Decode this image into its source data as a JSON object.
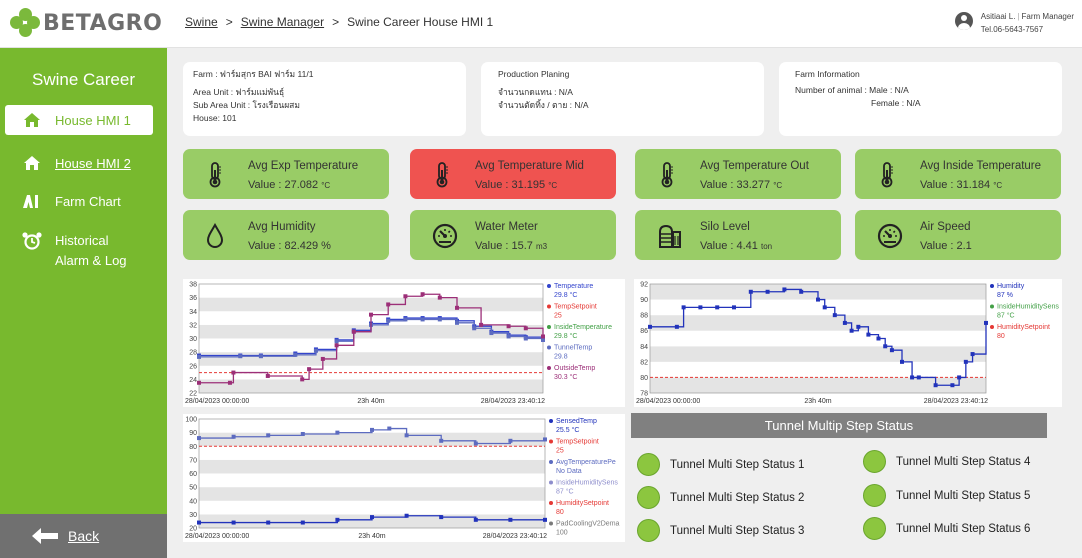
{
  "brand": {
    "name": "BETAGRO",
    "accent": "#78b92e",
    "card_green": "#99cc66",
    "alarm_red": "#ef5350"
  },
  "breadcrumb": {
    "root": "Swine",
    "sep1": ">",
    "section": "Swine Manager",
    "sep2": ">",
    "current": "Swine Career House HMI 1"
  },
  "user": {
    "name": "Asitiaai L.",
    "role": "Farm Manager",
    "phone": "Tel.06-5643-7567"
  },
  "sidebar": {
    "title": "Swine Career",
    "items": [
      {
        "label": "House HMI 1",
        "icon": "house-icon"
      },
      {
        "label": "House HMI 2",
        "icon": "house-icon"
      },
      {
        "label": "Farm Chart",
        "icon": "chart-icon"
      },
      {
        "label": "Historical",
        "label2": "Alarm & Log",
        "icon": "alarm-clock-icon"
      }
    ],
    "back_label": "Back"
  },
  "farm": {
    "farm": "Farm :  ฟาร์มสุกร BAI ฟาร์ม 11/1",
    "area": "Area Unit :  ฟาร์มแม่พันธุ์",
    "sub_area": "Sub Area Unit :  โรงเรือนผสม",
    "house": "House:  101"
  },
  "production": {
    "title": "Production Planing",
    "line1": "จำนวนกดแทน :  N/A",
    "line2": "จำนวนตัดทิ้ง / ตาย :  N/A"
  },
  "farm_info": {
    "title": "Farm Information",
    "line1": "Number of animal : Male :  N/A",
    "line2": "Female :  N/A"
  },
  "cards": [
    {
      "label": "Avg Exp Temperature",
      "value": "Value :   27.082",
      "unit": "°C",
      "icon": "thermometer-icon"
    },
    {
      "label": "Avg Temperature Mid",
      "value": "Value :   31.195",
      "unit": "°C",
      "icon": "thermometer-icon"
    },
    {
      "label": "Avg Temperature Out",
      "value": "Value :  33.277",
      "unit": "°C",
      "icon": "thermometer-icon"
    },
    {
      "label": "Avg Inside Temperature",
      "value": "Value :  31.184",
      "unit": "°C",
      "icon": "thermometer-icon"
    },
    {
      "label": "Avg Humidity",
      "value": "Value : 82.429 %",
      "unit": "",
      "icon": "water-drop-icon"
    },
    {
      "label": "Water Meter",
      "value": "Value :  15.7",
      "unit": "m3",
      "icon": "gauge-icon"
    },
    {
      "label": "Silo Level",
      "value": "Value :  4.41",
      "unit": "ton",
      "icon": "silo-icon"
    },
    {
      "label": "Air Speed",
      "value": "Value :   2.1",
      "unit": "",
      "icon": "gauge-icon"
    }
  ],
  "chart_data": [
    {
      "type": "line",
      "x_labels": [
        "28/04/2023 00:00:00",
        "23h 40m",
        "28/04/2023 23:40:12"
      ],
      "ylim": [
        22,
        38
      ],
      "y_ticks": [
        22,
        24,
        26,
        28,
        30,
        32,
        34,
        36,
        38
      ],
      "setpoint": 25,
      "series": [
        {
          "name": "Temperature",
          "value_text": "29.8 °C",
          "color": "#3344cc",
          "x": [
            0,
            0.12,
            0.18,
            0.28,
            0.34,
            0.4,
            0.45,
            0.5,
            0.55,
            0.6,
            0.65,
            0.7,
            0.75,
            0.8,
            0.85,
            0.9,
            0.95,
            1.0
          ],
          "y": [
            27.5,
            27.5,
            27.5,
            27.8,
            28.4,
            29.8,
            31.2,
            32.2,
            32.8,
            33.0,
            33.0,
            33.0,
            32.6,
            31.8,
            31.0,
            30.5,
            30.2,
            29.8
          ]
        },
        {
          "name": "TempSetpoint",
          "value_text": "25",
          "color": "#e53935"
        },
        {
          "name": "InsideTemperature",
          "value_text": "29.8 °C",
          "color": "#43a047"
        },
        {
          "name": "TunnelTemp",
          "value_text": "29.8",
          "color": "#5c6bc0",
          "x": [
            0,
            0.12,
            0.18,
            0.28,
            0.34,
            0.4,
            0.45,
            0.5,
            0.55,
            0.6,
            0.65,
            0.7,
            0.75,
            0.8,
            0.85,
            0.9,
            0.95,
            1.0
          ],
          "y": [
            27.3,
            27.4,
            27.4,
            27.6,
            28.2,
            29.6,
            31.0,
            32.0,
            32.6,
            32.8,
            32.8,
            32.8,
            32.3,
            31.5,
            30.8,
            30.3,
            30.0,
            29.8
          ]
        },
        {
          "name": "OutsideTemp",
          "value_text": "30.3 °C",
          "color": "#9c2f78",
          "x": [
            0,
            0.09,
            0.1,
            0.2,
            0.3,
            0.32,
            0.36,
            0.4,
            0.45,
            0.5,
            0.55,
            0.6,
            0.65,
            0.7,
            0.75,
            0.82,
            0.9,
            0.95,
            1.0
          ],
          "y": [
            23.5,
            23.5,
            25.0,
            24.5,
            24.0,
            25.5,
            27.0,
            29.0,
            31.0,
            33.5,
            35.0,
            36.2,
            36.5,
            36.0,
            34.5,
            32.0,
            31.8,
            31.5,
            30.3
          ]
        }
      ]
    },
    {
      "type": "line",
      "x_labels": [
        "28/04/2023 00:00:00",
        "23h 40m",
        "28/04/2023 23:40:12"
      ],
      "ylim": [
        78,
        92
      ],
      "y_ticks": [
        78,
        80,
        82,
        84,
        86,
        88,
        90,
        92
      ],
      "setpoint": 80,
      "series": [
        {
          "name": "Humidity",
          "value_text": "87 %",
          "color": "#2233bb",
          "x": [
            0,
            0.08,
            0.1,
            0.15,
            0.2,
            0.25,
            0.3,
            0.35,
            0.4,
            0.45,
            0.5,
            0.52,
            0.55,
            0.58,
            0.6,
            0.62,
            0.65,
            0.68,
            0.7,
            0.72,
            0.75,
            0.78,
            0.8,
            0.85,
            0.9,
            0.92,
            0.94,
            0.96,
            1.0
          ],
          "y": [
            86.5,
            86.5,
            89,
            89,
            89,
            89,
            91,
            91,
            91.3,
            91,
            90,
            89,
            88,
            87,
            86,
            86.5,
            85.5,
            85,
            84,
            83.5,
            82,
            80,
            80,
            79,
            79,
            80,
            82,
            83,
            87
          ]
        },
        {
          "name": "InsideHumiditySens",
          "value_text": "87 °C",
          "color": "#43a047"
        },
        {
          "name": "HumiditySetpoint",
          "value_text": "80",
          "color": "#e53935"
        }
      ]
    },
    {
      "type": "line",
      "x_labels": [
        "28/04/2023 00:00:00",
        "23h 40m",
        "28/04/2023 23:40:12"
      ],
      "ylim": [
        20,
        100
      ],
      "y_ticks": [
        20,
        30,
        40,
        50,
        60,
        70,
        80,
        90,
        100
      ],
      "setpoint": 80,
      "series": [
        {
          "name": "SensedTemp",
          "value_text": "25.5 °C",
          "color": "#2233bb",
          "x": [
            0,
            0.1,
            0.2,
            0.3,
            0.4,
            0.5,
            0.6,
            0.7,
            0.8,
            0.9,
            1.0
          ],
          "y": [
            24,
            24,
            24,
            24,
            26,
            28,
            29,
            28,
            26,
            26,
            26
          ]
        },
        {
          "name": "TempSetpoint",
          "value_text": "25",
          "color": "#e53935"
        },
        {
          "name": "AvgTemperaturePe",
          "value_text": "No Data",
          "color": "#5c6bc0",
          "x": [
            0,
            0.1,
            0.2,
            0.3,
            0.4,
            0.5,
            0.55,
            0.6,
            0.7,
            0.8,
            0.9,
            1.0
          ],
          "y": [
            86,
            87,
            88,
            89,
            90,
            92,
            93,
            88,
            84,
            82,
            84,
            85
          ]
        },
        {
          "name": "InsideHumiditySens",
          "value_text": "87 °C",
          "color": "#8e8ecc"
        },
        {
          "name": "HumiditySetpoint",
          "value_text": "80",
          "color": "#e53935"
        },
        {
          "name": "PadCoolingV2Dema",
          "value_text": "100",
          "color": "#7a7a7a"
        }
      ]
    }
  ],
  "tunnel": {
    "title": "Tunnel Multip Step Status",
    "items": [
      "Tunnel Multi Step Status 1",
      "Tunnel Multi Step Status 2",
      "Tunnel Multi Step Status 3",
      "Tunnel Multi Step Status 4",
      "Tunnel Multi Step Status 5",
      "Tunnel Multi Step Status 6"
    ]
  }
}
